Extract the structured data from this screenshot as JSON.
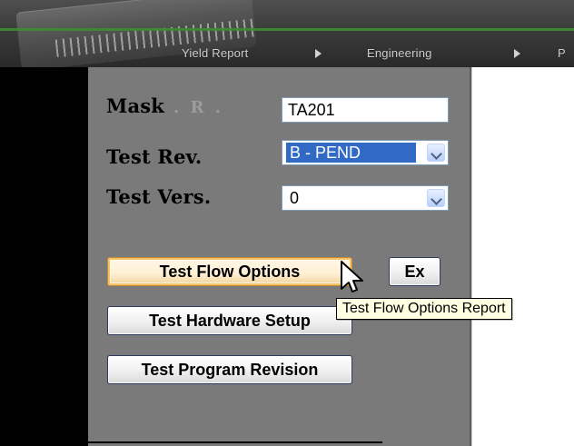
{
  "nav": {
    "items": [
      "Yield Report",
      "Engineering",
      "P"
    ]
  },
  "form": {
    "mask": {
      "label": "Mask",
      "faint_suffix": ". R .",
      "value": "TA201"
    },
    "test_rev": {
      "label": "Test Rev.",
      "selected_value": "B - PEND"
    },
    "test_vers": {
      "label": "Test Vers.",
      "selected_value": "0"
    }
  },
  "buttons": {
    "test_flow_options": "Test Flow Options",
    "ex": "Ex",
    "test_hardware_setup": "Test Hardware Setup",
    "test_program_revision": "Test Program Revision"
  },
  "tooltip": {
    "text": "Test Flow Options Report"
  },
  "colors": {
    "accent_green": "#3a8f2f",
    "selection_blue": "#316ac5",
    "tooltip_bg": "#ffffe1"
  },
  "icons": {
    "dropdown_arrow": "chevron-down-icon",
    "mouse_cursor": "mouse-pointer-icon"
  }
}
